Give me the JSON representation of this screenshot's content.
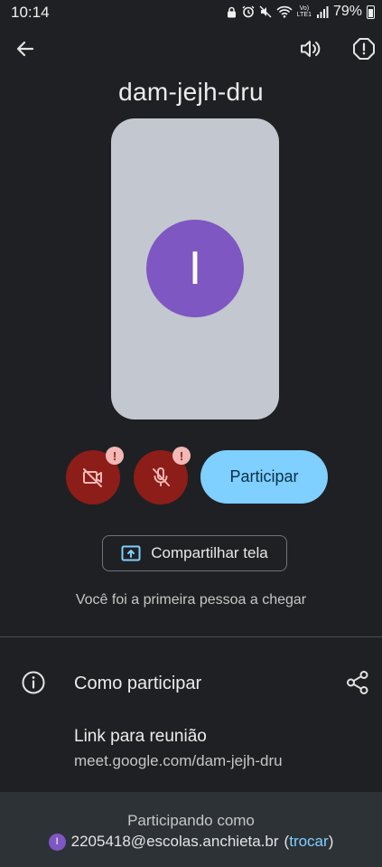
{
  "status_bar": {
    "time": "10:14",
    "network_label": "Vo)\nLTE1",
    "battery_percent": "79%"
  },
  "meeting": {
    "code": "dam-jejh-dru",
    "avatar_initial": "I"
  },
  "controls": {
    "join_label": "Participar",
    "share_screen_label": "Compartilhar tela",
    "warning_glyph": "!"
  },
  "first_to_join_msg": "Você foi a primeira pessoa a chegar",
  "how_to_join": {
    "title": "Como participar",
    "link_label": "Link para reunião",
    "link_value": "meet.google.com/dam-jejh-dru"
  },
  "footer": {
    "joining_as_label": "Participando como",
    "account_initial": "I",
    "account_email": "2205418@escolas.anchieta.br",
    "paren_open": "(",
    "switch_label": "trocar",
    "paren_close": ")"
  },
  "colors": {
    "background": "#1f2023",
    "preview_tile": "#c3c7cf",
    "avatar": "#7e57c2",
    "muted_red": "#8c1d18",
    "join_blue": "#7fcfff",
    "footer": "#2d3236"
  }
}
